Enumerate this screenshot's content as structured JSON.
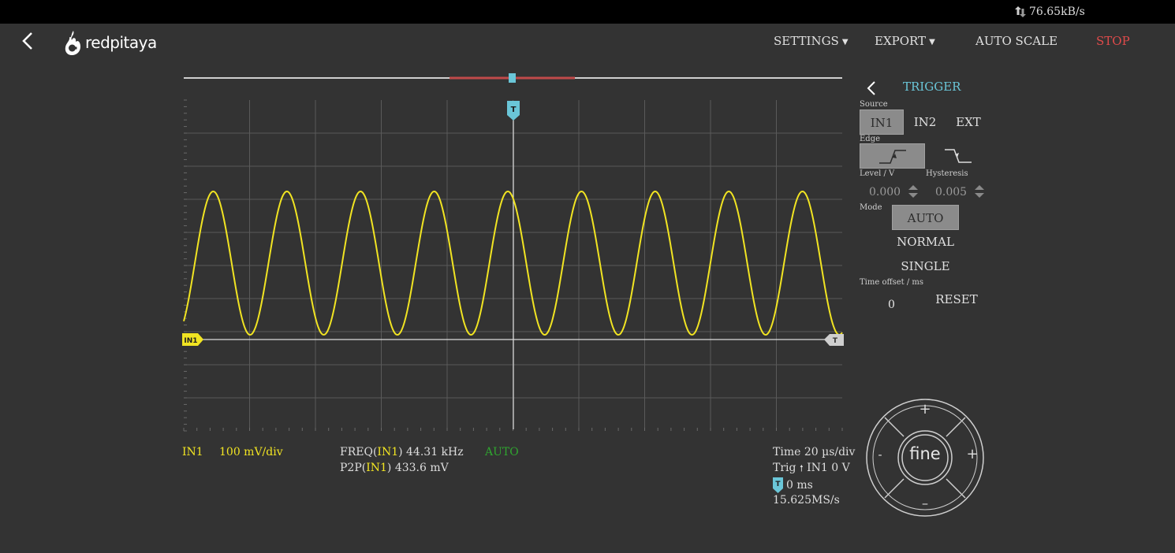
{
  "status_bar": {
    "network_rate": "76.65kB/s"
  },
  "header": {
    "logo_text": "redpitaya",
    "menus": {
      "settings": "SETTINGS",
      "export": "EXPORT",
      "auto_scale": "AUTO SCALE",
      "stop": "STOP"
    }
  },
  "plot": {
    "channel_marker": "IN1",
    "trigger_marker": "T",
    "trigger_level_marker": "T"
  },
  "bottom": {
    "channel": "IN1",
    "scale": "100  mV/div",
    "freq_prefix": "FREQ(",
    "freq_channel": "IN1",
    "freq_value": ") 44.31  kHz",
    "p2p_prefix": "P2P(",
    "p2p_channel": "IN1",
    "p2p_value": ") 433.6  mV",
    "mode_status": "AUTO",
    "time_label": "Time 20  µs/div",
    "trig_prefix": "Trig",
    "trig_value": "IN1 0 V",
    "offset_marker": "T",
    "offset_value": "0 ms",
    "sample_rate": "15.625MS/s"
  },
  "trigger_panel": {
    "title": "TRIGGER",
    "source_label": "Source",
    "sources": [
      "IN1",
      "IN2",
      "EXT"
    ],
    "selected_source": "IN1",
    "edge_label": "Edge",
    "level_label": "Level / V",
    "hysteresis_label": "Hysteresis",
    "level_value": "0.000",
    "hysteresis_value": "0.005",
    "mode_label": "Mode",
    "modes": [
      "AUTO",
      "NORMAL",
      "SINGLE"
    ],
    "selected_mode": "AUTO",
    "time_offset_label": "Time offset  / ms",
    "time_offset_value": "0",
    "reset_label": "RESET"
  },
  "wheel": {
    "center_label": "fine",
    "top": "+",
    "bottom": "–",
    "left": "-",
    "right": "+"
  },
  "colors": {
    "background": "#333333",
    "grid": "#5a5a5a",
    "signal": "#f1e422",
    "trigger_accent": "#6ac6d8",
    "stop": "#e04b4b",
    "auto_status": "#2fa52f"
  },
  "signal": {
    "channel": "IN1",
    "waveform": "sine",
    "frequency_khz": 44.31,
    "peak_to_peak_mv": 433.6
  }
}
